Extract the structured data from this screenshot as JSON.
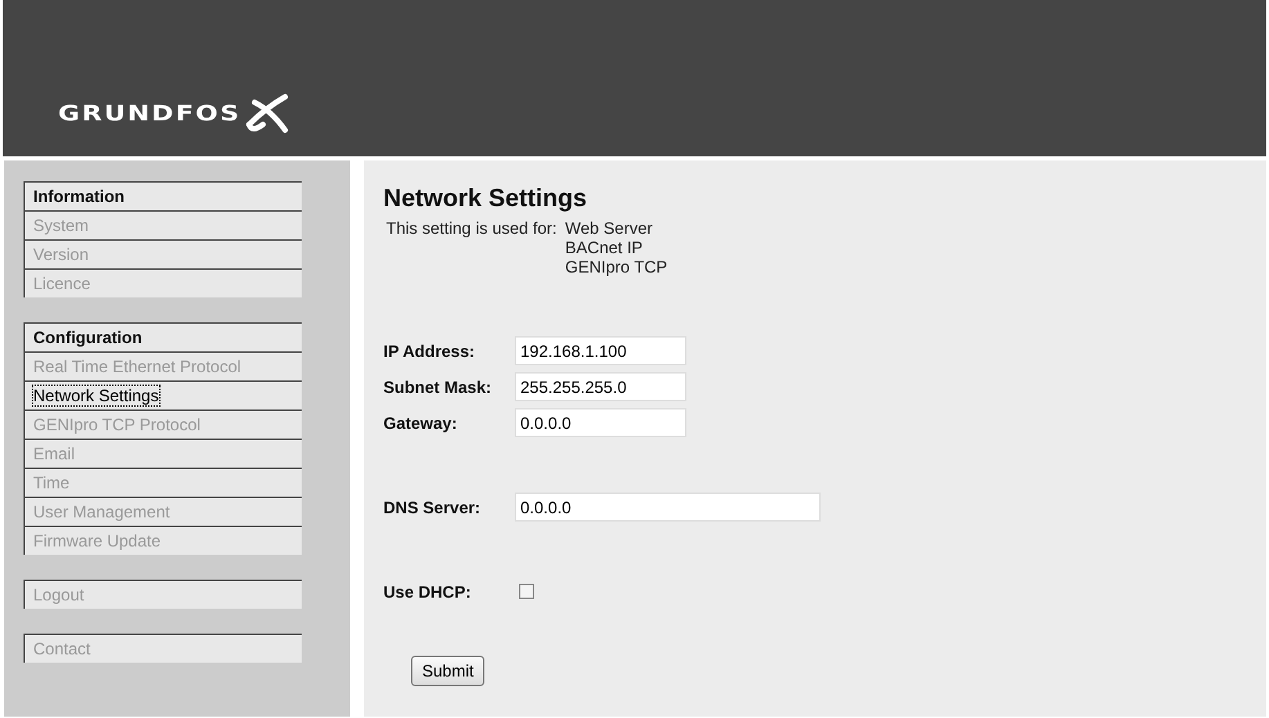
{
  "header": {
    "logo": "GRUNDFOS"
  },
  "sidebar": {
    "groups": [
      {
        "heading": "Information",
        "items": [
          {
            "label": "System",
            "selected": false
          },
          {
            "label": "Version",
            "selected": false
          },
          {
            "label": "Licence",
            "selected": false
          }
        ]
      },
      {
        "heading": "Configuration",
        "items": [
          {
            "label": "Real Time Ethernet Protocol",
            "selected": false
          },
          {
            "label": "Network Settings",
            "selected": true
          },
          {
            "label": "GENIpro TCP Protocol",
            "selected": false
          },
          {
            "label": "Email",
            "selected": false
          },
          {
            "label": "Time",
            "selected": false
          },
          {
            "label": "User Management",
            "selected": false
          },
          {
            "label": "Firmware Update",
            "selected": false
          }
        ]
      },
      {
        "items": [
          {
            "label": "Logout",
            "selected": false
          }
        ]
      },
      {
        "items": [
          {
            "label": "Contact",
            "selected": false
          }
        ]
      }
    ]
  },
  "content": {
    "title": "Network Settings",
    "used_for_label": "This setting is used for:",
    "used_for": [
      "Web Server",
      "BACnet IP",
      "GENIpro TCP"
    ],
    "field_groups": [
      {
        "fields": [
          {
            "kind": "text",
            "label": "IP Address:",
            "value": "192.168.1.100"
          },
          {
            "kind": "text",
            "label": "Subnet Mask:",
            "value": "255.255.255.0"
          },
          {
            "kind": "text",
            "label": "Gateway:",
            "value": "0.0.0.0"
          }
        ]
      },
      {
        "fields": [
          {
            "kind": "text",
            "label": "DNS Server:",
            "value": "0.0.0.0"
          }
        ]
      },
      {
        "fields": [
          {
            "kind": "checkbox",
            "label": "Use DHCP:",
            "checked": false
          }
        ]
      }
    ],
    "submit": "Submit"
  }
}
